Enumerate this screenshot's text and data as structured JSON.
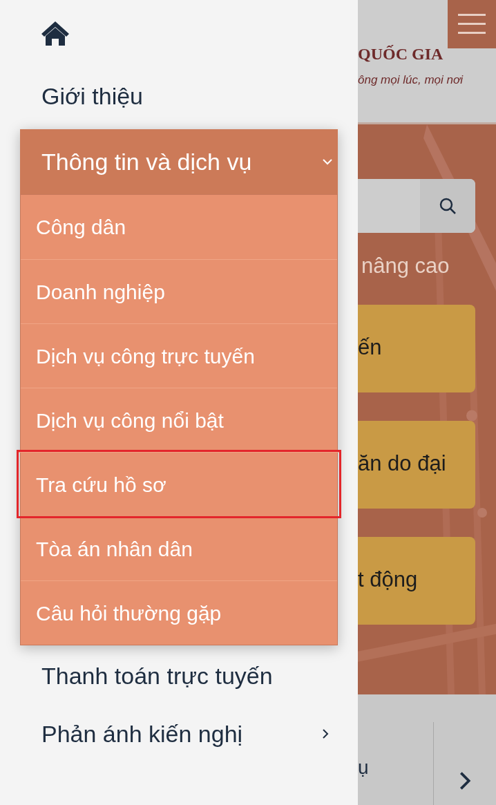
{
  "drawer": {
    "items": [
      {
        "kind": "home"
      },
      {
        "kind": "link",
        "label": "Giới thiệu"
      },
      {
        "kind": "dropdown",
        "label": "Thông tin và dịch vụ",
        "expanded": true,
        "children": [
          {
            "label": "Công dân",
            "highlighted": false
          },
          {
            "label": "Doanh nghiệp",
            "highlighted": false
          },
          {
            "label": "Dịch vụ công trực tuyến",
            "highlighted": false
          },
          {
            "label": "Dịch vụ công nổi bật",
            "highlighted": false
          },
          {
            "label": "Tra cứu hồ sơ",
            "highlighted": true
          },
          {
            "label": "Tòa án nhân dân",
            "highlighted": false
          },
          {
            "label": "Câu hỏi thường gặp",
            "highlighted": false
          }
        ]
      },
      {
        "kind": "link",
        "label": "Thanh toán trực tuyến"
      },
      {
        "kind": "submenu",
        "label": "Phản ánh kiến nghị"
      }
    ]
  },
  "background_page": {
    "title": "QUỐC GIA",
    "tagline": "ông mọi lúc, mọi nơi",
    "search_link": "nâng cao",
    "cards": [
      "ến",
      "ăn do đại",
      "t động"
    ],
    "bottom_text": "ụ"
  }
}
